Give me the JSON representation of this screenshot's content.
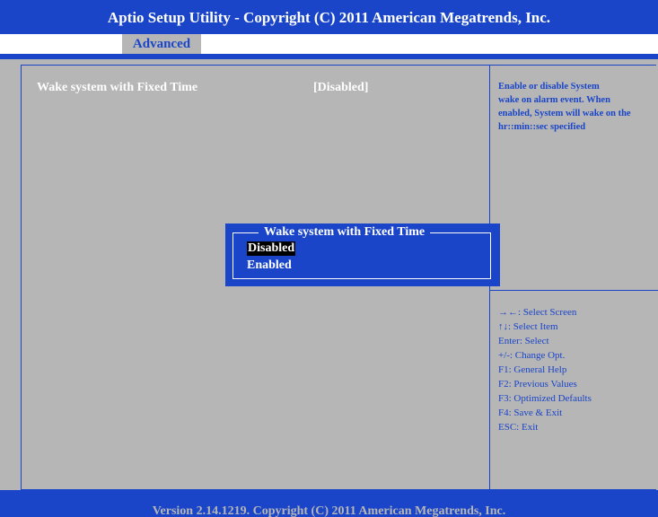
{
  "header": {
    "title": "Aptio Setup Utility - Copyright (C) 2011 American Megatrends, Inc.",
    "active_tab": "Advanced"
  },
  "setting": {
    "label": "Wake system with Fixed Time",
    "value": "[Disabled]"
  },
  "help": {
    "lines": [
      "Enable or disable System",
      "wake on alarm event. When",
      "enabled, System will wake on the",
      "hr::min::sec specified"
    ]
  },
  "keys": [
    "→←: Select Screen",
    "↑↓: Select Item",
    "Enter: Select",
    "+/-: Change Opt.",
    "F1: General Help",
    "F2: Previous Values",
    "F3: Optimized Defaults",
    "F4: Save & Exit",
    "ESC: Exit"
  ],
  "popup": {
    "title": "Wake system with Fixed Time",
    "options": [
      "Disabled",
      "Enabled"
    ],
    "selected": "Disabled"
  },
  "footer": {
    "text": "Version 2.14.1219. Copyright (C) 2011 American Megatrends, Inc."
  },
  "colors": {
    "blue": "#1a45c8",
    "gray": "#b6b6b6",
    "white": "#ffffff",
    "highlight": "#000000"
  }
}
